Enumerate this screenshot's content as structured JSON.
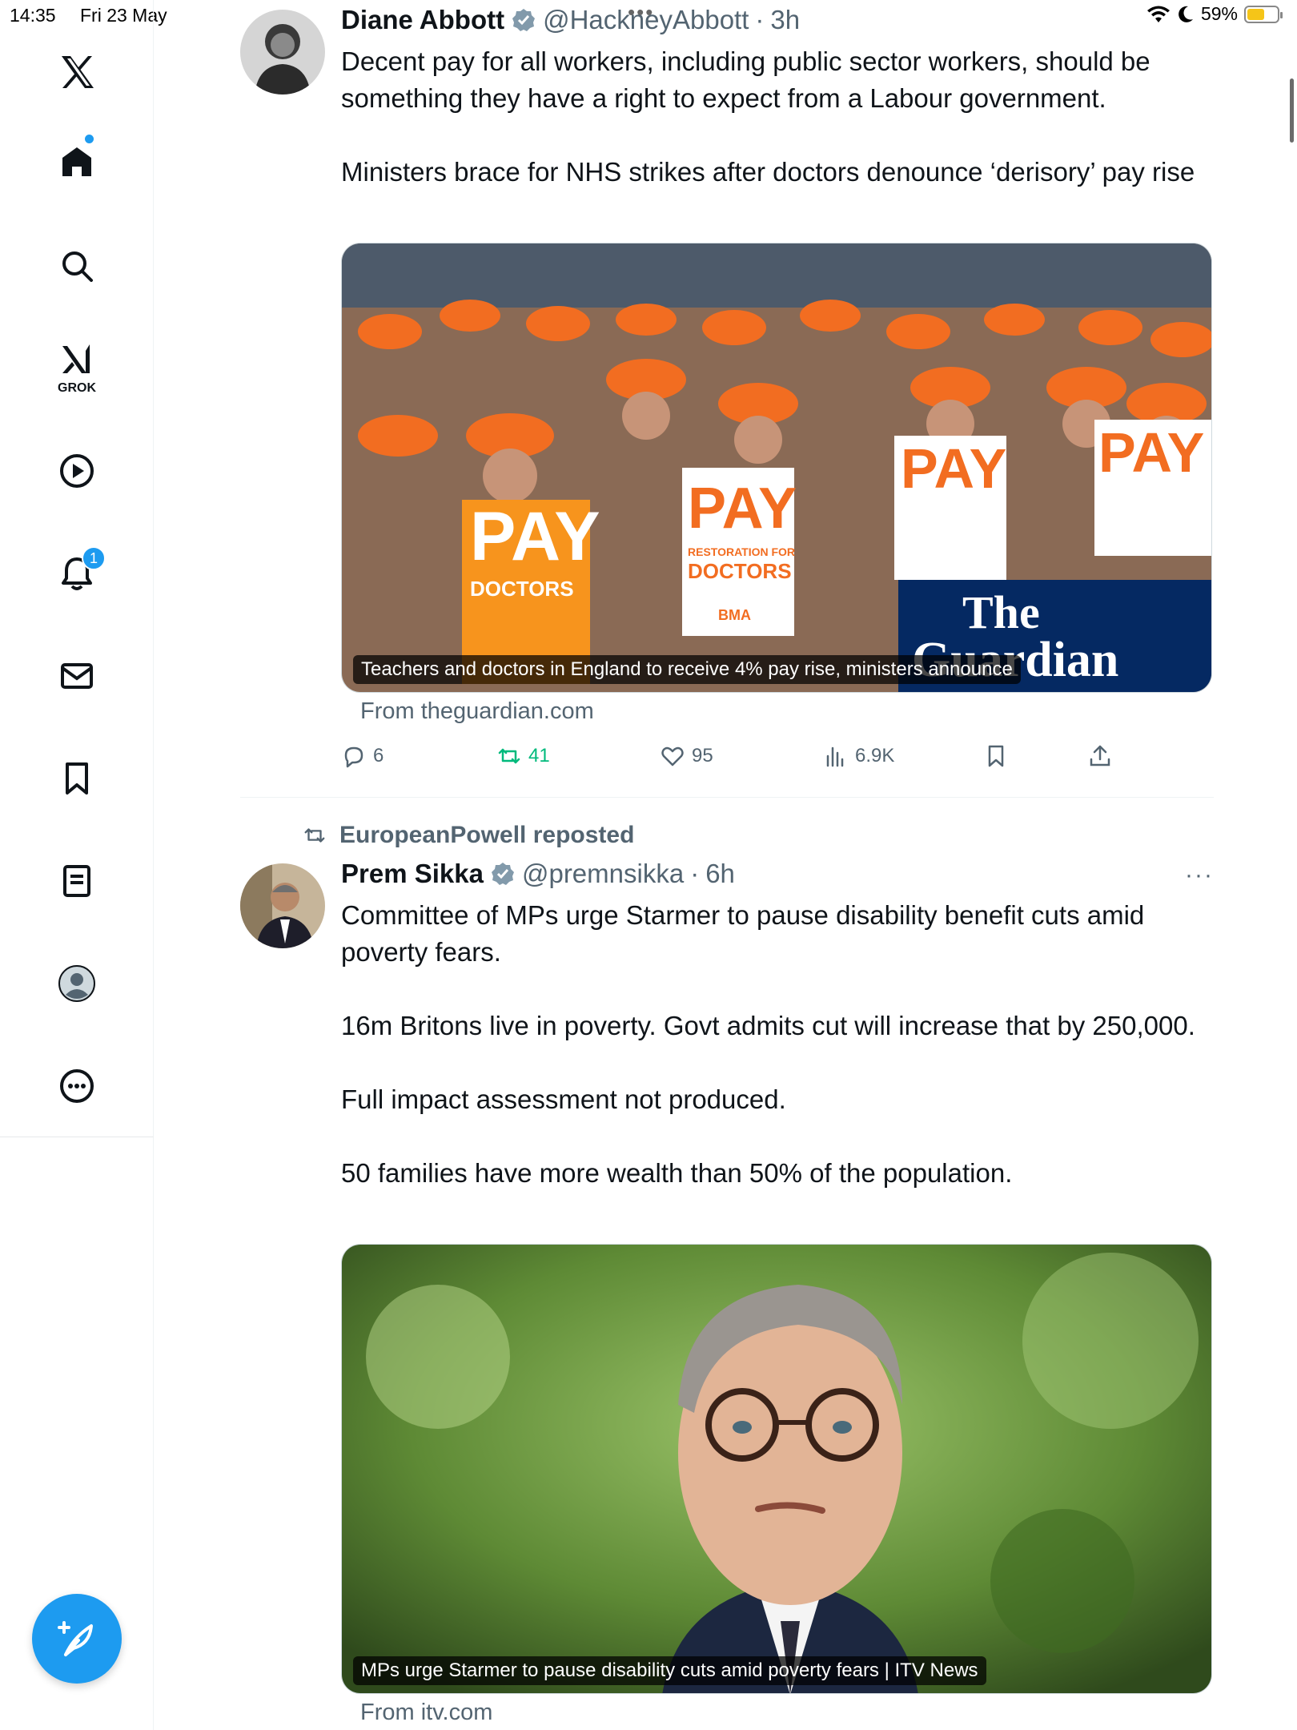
{
  "status_bar": {
    "time": "14:35",
    "date": "Fri 23 May",
    "battery": "59%",
    "battery_level": 0.59
  },
  "sidebar": {
    "grok_label": "GROK",
    "notification_count": "1"
  },
  "tweets": [
    {
      "display_name": "Diane Abbott",
      "handle": "@HackneyAbbott",
      "separator": "·",
      "time": "3h",
      "text_paragraphs": [
        "Decent pay for all workers, including public sector workers, should be something they have a right to expect from a Labour government.",
        "Ministers brace for NHS strikes after doctors denounce ‘derisory’ pay rise"
      ],
      "card_caption": "Teachers and doctors in England to receive 4% pay rise, ministers announce",
      "card_source": "From theguardian.com",
      "card_image_texts": [
        "PAY",
        "RESTORATION FOR",
        "DOCTORS",
        "BMA",
        "The",
        "Guardian"
      ],
      "replies": "6",
      "reposts": "41",
      "likes": "95",
      "views": "6.9K"
    },
    {
      "repost_by": "EuropeanPowell reposted",
      "display_name": "Prem Sikka",
      "handle": "@premnsikka",
      "separator": "·",
      "time": "6h",
      "text_paragraphs": [
        "Committee of MPs urge Starmer to pause disability benefit cuts amid poverty fears.",
        "16m Britons live in poverty. Govt admits cut will increase that by 250,000.",
        "Full impact assessment not produced.",
        "50 families have more wealth than 50% of the population."
      ],
      "card_caption": "MPs urge Starmer to pause disability cuts amid poverty fears | ITV News",
      "card_source": "From itv.com"
    }
  ],
  "colors": {
    "accent": "#1d9bf0",
    "repost_green": "#00ba7c",
    "muted": "#536471",
    "text": "#0f1419",
    "guardian_blue": "#052962",
    "placard_orange": "#f7941d"
  },
  "icons": {
    "nav": [
      "x-logo-icon",
      "home-icon",
      "search-icon",
      "grok-icon",
      "video-icon",
      "bell-icon",
      "mail-icon",
      "bookmark-icon",
      "lists-icon",
      "profile-icon",
      "more-icon"
    ],
    "actions": [
      "reply-icon",
      "repost-icon",
      "like-icon",
      "views-icon",
      "bookmark-icon",
      "share-icon"
    ]
  }
}
